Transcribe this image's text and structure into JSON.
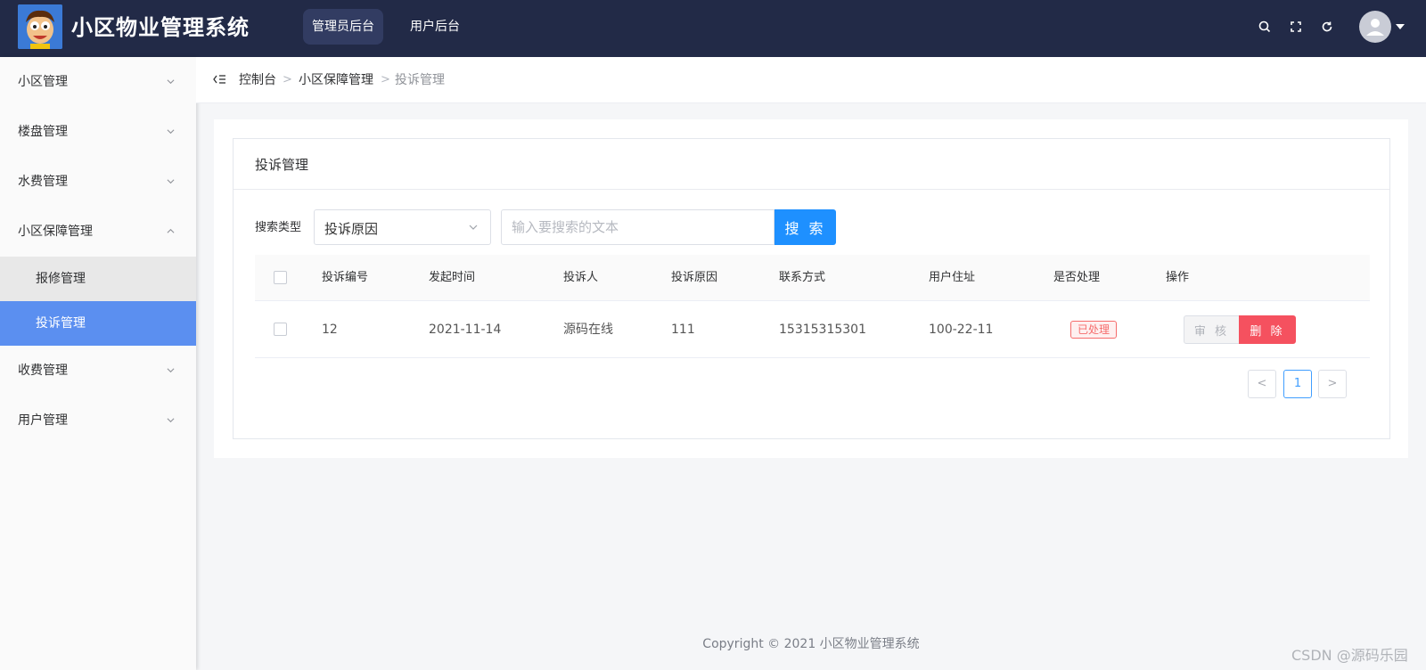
{
  "header": {
    "app_title": "小区物业管理系统",
    "tabs": [
      {
        "label": "管理员后台",
        "active": true
      },
      {
        "label": "用户后台",
        "active": false
      }
    ],
    "icons": [
      "search-icon",
      "fullscreen-icon",
      "refresh-icon",
      "user-avatar",
      "caret-down-icon"
    ],
    "bg_color": "#222a47"
  },
  "sidebar": {
    "items": [
      {
        "label": "小区管理"
      },
      {
        "label": "楼盘管理"
      },
      {
        "label": "水费管理"
      },
      {
        "label": "小区保障管理",
        "expanded": true,
        "children": [
          {
            "label": "报修管理"
          },
          {
            "label": "投诉管理",
            "active": true
          }
        ]
      },
      {
        "label": "收费管理"
      },
      {
        "label": "用户管理"
      }
    ],
    "active_color": "#5b8ff0"
  },
  "breadcrumb": [
    "控制台",
    "小区保障管理",
    "投诉管理"
  ],
  "card": {
    "title": "投诉管理",
    "search": {
      "label": "搜索类型",
      "selected_type": "投诉原因",
      "placeholder": "输入要搜索的文本",
      "button_label": "搜 索"
    },
    "table": {
      "columns": [
        "投诉编号",
        "发起时间",
        "投诉人",
        "投诉原因",
        "联系方式",
        "用户住址",
        "是否处理",
        "操作"
      ],
      "rows": [
        {
          "id": "12",
          "date": "2021-11-14",
          "complainant": "源码在线",
          "reason": "111",
          "phone": "15315315301",
          "address": "100-22-11",
          "status": "已处理",
          "actions": [
            "审 核",
            "删 除"
          ]
        }
      ]
    },
    "pagination": {
      "prev": "<",
      "current": "1",
      "next": ">"
    }
  },
  "footer": "Copyright © 2021 小区物业管理系统",
  "watermark": "CSDN @源码乐园"
}
